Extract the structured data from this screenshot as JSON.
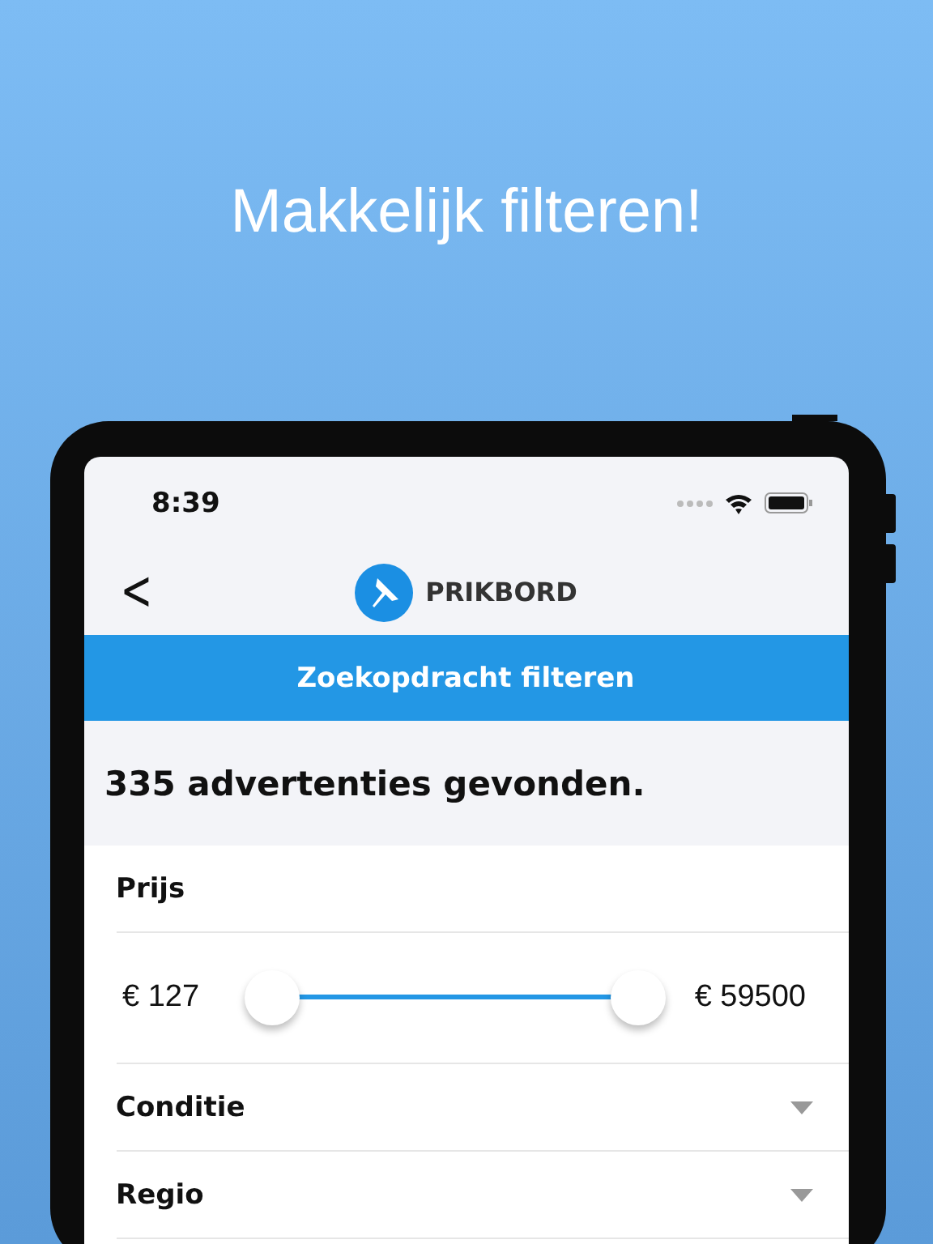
{
  "headline": "Makkelijk filteren!",
  "status_bar": {
    "time": "8:39"
  },
  "nav": {
    "back": "<",
    "app_name": "PRIKBORD"
  },
  "title_bar": "Zoekopdracht filteren",
  "result_count": "335 advertenties gevonden.",
  "filters": [
    {
      "kind": "header",
      "label": "Prijs"
    },
    {
      "kind": "range",
      "min_label": "€ 127",
      "max_label": "€ 59500",
      "low": {
        "level": 0
      },
      "high": {
        "level": 1
      }
    },
    {
      "kind": "dropdown",
      "label": "Conditie"
    },
    {
      "kind": "dropdown",
      "label": "Regio"
    }
  ]
}
